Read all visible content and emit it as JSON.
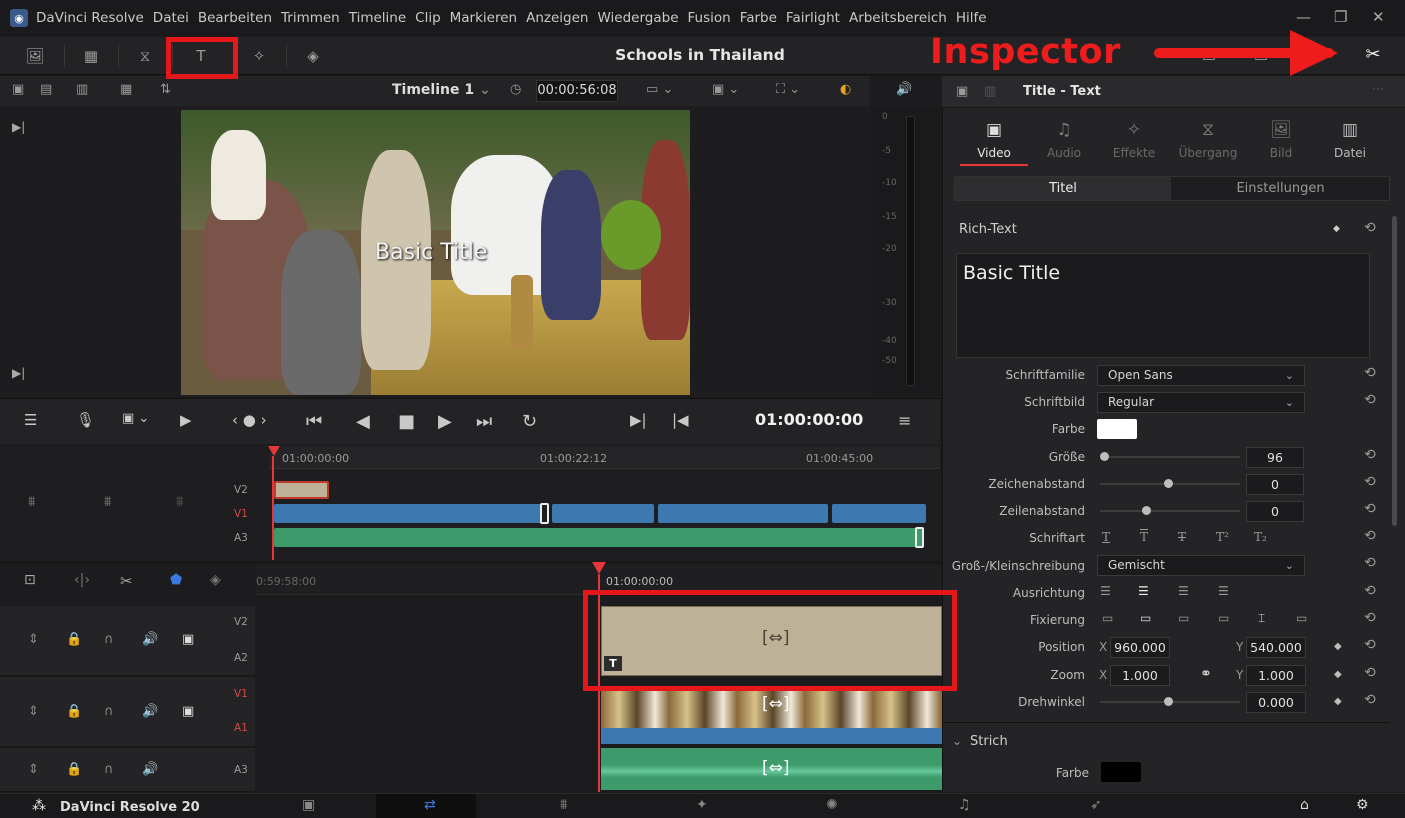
{
  "app": {
    "name": "DaVinci Resolve",
    "version_label": "DaVinci Resolve 20"
  },
  "menu": [
    "Datei",
    "Bearbeiten",
    "Trimmen",
    "Timeline",
    "Clip",
    "Markieren",
    "Anzeigen",
    "Wiedergabe",
    "Fusion",
    "Farbe",
    "Fairlight",
    "Arbeitsbereich",
    "Hilfe"
  ],
  "project": {
    "title": "Schools in Thailand"
  },
  "annotation": {
    "label": "Inspector",
    "color": "#e5171a"
  },
  "viewer": {
    "timeline_name": "Timeline 1",
    "timecode": "00:00:56:08",
    "overlay_title": "Basic Title",
    "playhead_tc": "01:00:00:00"
  },
  "meter_labels": [
    "0",
    "-5",
    "-10",
    "-15",
    "-20",
    "-30",
    "-40",
    "-50"
  ],
  "upper_timeline": {
    "ruler": [
      "01:00:00:00",
      "01:00:22:12",
      "01:00:45:00"
    ],
    "tracks": [
      "V2",
      "V1",
      "A3"
    ]
  },
  "lower_timeline": {
    "ruler_left": "0:59:58:00",
    "ruler_playhead": "01:00:00:00",
    "tracks": [
      [
        "V2",
        "A2"
      ],
      [
        "V1",
        "A1"
      ],
      [
        "A3"
      ]
    ]
  },
  "inspector": {
    "title": "Title - Text",
    "tabs": [
      "Video",
      "Audio",
      "Effekte",
      "Übergang",
      "Bild",
      "Datei"
    ],
    "subtabs": [
      "Titel",
      "Einstellungen"
    ],
    "section_richtext": "Rich-Text",
    "text_value": "Basic Title",
    "fields": {
      "font_family_label": "Schriftfamilie",
      "font_family": "Open Sans",
      "font_style_label": "Schriftbild",
      "font_style": "Regular",
      "color_label": "Farbe",
      "size_label": "Größe",
      "size": "96",
      "tracking_label": "Zeichenabstand",
      "tracking": "0",
      "line_spacing_label": "Zeilenabstand",
      "line_spacing": "0",
      "font_type_label": "Schriftart",
      "case_label": "Groß-/Kleinschreibung",
      "case": "Gemischt",
      "align_label": "Ausrichtung",
      "anchor_label": "Fixierung",
      "position_label": "Position",
      "pos_x_label": "X",
      "pos_x": "960.000",
      "pos_y_label": "Y",
      "pos_y": "540.000",
      "zoom_label": "Zoom",
      "zoom_x_label": "X",
      "zoom_x": "1.000",
      "zoom_y_label": "Y",
      "zoom_y": "1.000",
      "rotation_label": "Drehwinkel",
      "rotation": "0.000"
    },
    "section_stroke": "Strich",
    "stroke_color_label": "Farbe"
  },
  "colors": {
    "accent_red": "#e5171a",
    "clip_title": "#bdb197",
    "clip_video": "#3e78b0",
    "clip_audio": "#3d9a6a"
  }
}
